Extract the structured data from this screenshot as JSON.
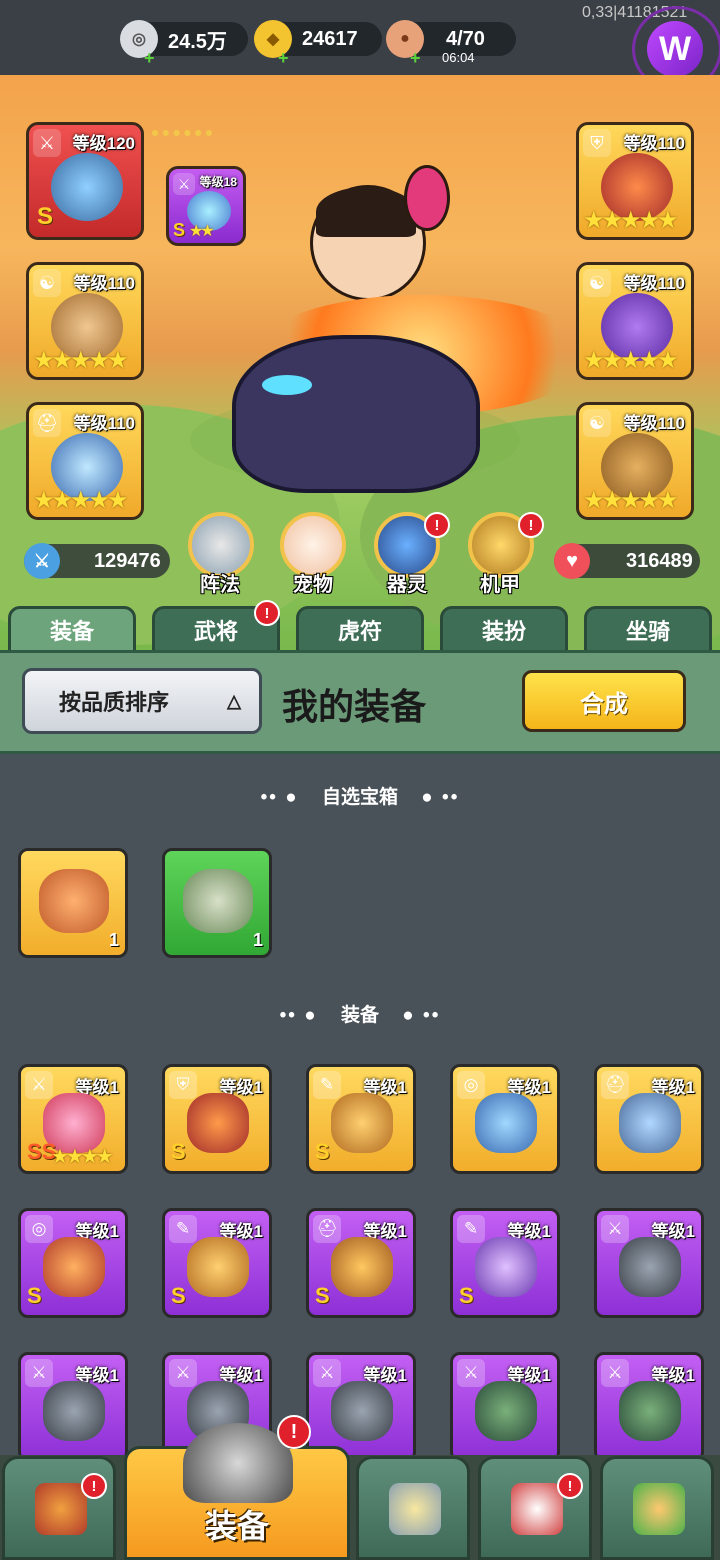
{
  "top": {
    "silver": "24.5万",
    "gold": "24617",
    "stamina": "4/70",
    "stamina_timer": "06:04",
    "debug_info": "0,33|41181521"
  },
  "hero": {
    "left_slots": [
      {
        "level": "等级120",
        "rank": "S",
        "type_icon": "sword-icon",
        "color": "red"
      },
      {
        "level": "等级110",
        "type_icon": "yin-yang-icon",
        "color": "gold"
      },
      {
        "level": "等级110",
        "type_icon": "helmet-icon",
        "color": "gold"
      }
    ],
    "linked_slot": {
      "level": "等级18",
      "rank": "S",
      "type_icon": "sword-icon",
      "color": "purple"
    },
    "right_slots": [
      {
        "level": "等级110",
        "type_icon": "armor-icon",
        "color": "gold"
      },
      {
        "level": "等级110",
        "type_icon": "bracer-icon",
        "color": "gold"
      },
      {
        "level": "等级110",
        "type_icon": "yin-yang-icon",
        "color": "gold"
      }
    ],
    "attack": "129476",
    "hp": "316489",
    "functions": [
      "阵法",
      "宠物",
      "器灵",
      "机甲"
    ]
  },
  "tabs": [
    "装备",
    "武将",
    "虎符",
    "装扮",
    "坐骑"
  ],
  "panel": {
    "sort_label": "按品质排序",
    "title": "我的装备",
    "merge_label": "合成"
  },
  "sections": {
    "chests": "自选宝箱",
    "equipment": "装备"
  },
  "chests": [
    {
      "count": "1",
      "color": "gold"
    },
    {
      "count": "1",
      "color": "green"
    }
  ],
  "equipment_rows": [
    [
      {
        "level": "等级1",
        "rank": "SS",
        "color": "gold",
        "icon": "sword-icon"
      },
      {
        "level": "等级1",
        "rank": "S",
        "color": "gold",
        "icon": "armor-icon"
      },
      {
        "level": "等级1",
        "rank": "S",
        "color": "gold",
        "icon": "bracer-icon"
      },
      {
        "level": "等级1",
        "rank": "",
        "color": "gold",
        "icon": "medal-icon"
      },
      {
        "level": "等级1",
        "rank": "",
        "color": "gold",
        "icon": "helmet-icon"
      }
    ],
    [
      {
        "level": "等级1",
        "rank": "S",
        "color": "purple",
        "icon": "medal-icon"
      },
      {
        "level": "等级1",
        "rank": "S",
        "color": "purple",
        "icon": "bracer-icon"
      },
      {
        "level": "等级1",
        "rank": "S",
        "color": "purple",
        "icon": "helmet-icon"
      },
      {
        "level": "等级1",
        "rank": "S",
        "color": "purple",
        "icon": "bracer-icon"
      },
      {
        "level": "等级1",
        "rank": "",
        "color": "purple",
        "icon": "sword-icon"
      }
    ],
    [
      {
        "level": "等级1",
        "rank": "",
        "color": "purple",
        "icon": "sword-icon"
      },
      {
        "level": "等级1",
        "rank": "",
        "color": "purple",
        "icon": "sword-icon"
      },
      {
        "level": "等级1",
        "rank": "",
        "color": "purple",
        "icon": "sword-icon"
      },
      {
        "level": "等级1",
        "rank": "",
        "color": "purple",
        "icon": "sword-icon"
      },
      {
        "level": "等级1",
        "rank": "",
        "color": "purple",
        "icon": "sword-icon"
      }
    ]
  ],
  "bottom_nav": {
    "active_label": "装备",
    "items": [
      "shop-icon",
      "equipment-helmet-icon",
      "battle-icon",
      "hero-icon",
      "upgrade-icon"
    ]
  }
}
